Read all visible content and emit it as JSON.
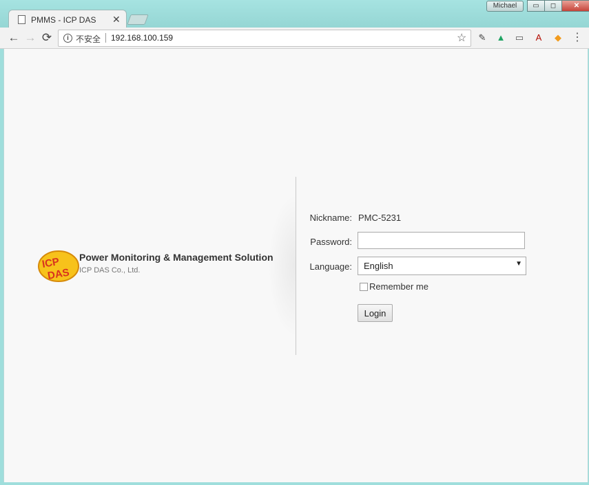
{
  "window": {
    "user": "Michael",
    "minimize": "▭",
    "restore": "◻",
    "close": "✕"
  },
  "tab": {
    "title": "PMMS - ICP DAS",
    "close": "✕"
  },
  "toolbar": {
    "back": "←",
    "forward": "→",
    "reload": "⟳",
    "security_label": "不安全",
    "url": "192.168.100.159",
    "bookmark": "☆",
    "menu": "⋮"
  },
  "extensions": [
    {
      "name": "pin-extension-icon",
      "glyph": "✎",
      "color": "#444"
    },
    {
      "name": "drive-extension-icon",
      "glyph": "▲",
      "color": "#1fa463"
    },
    {
      "name": "cast-icon",
      "glyph": "▭",
      "color": "#555"
    },
    {
      "name": "pdf-extension-icon",
      "glyph": "A",
      "color": "#b30b00"
    },
    {
      "name": "rss-extension-icon",
      "glyph": "◆",
      "color": "#f29b1d"
    }
  ],
  "brand": {
    "logo_text_top": "ICP",
    "logo_text_bottom": "DAS",
    "title": "Power Monitoring & Management Solution",
    "subtitle": "ICP DAS Co., Ltd."
  },
  "login": {
    "nickname_label": "Nickname:",
    "nickname_value": "PMC-5231",
    "password_label": "Password:",
    "password_value": "",
    "language_label": "Language:",
    "language_value": "English",
    "remember_label": "Remember me",
    "login_button": "Login"
  }
}
